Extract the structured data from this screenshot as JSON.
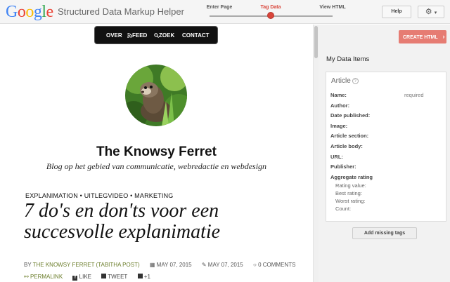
{
  "header": {
    "logo": {
      "letters": [
        {
          "char": "G",
          "color": "#4285f4"
        },
        {
          "char": "o",
          "color": "#ea4335"
        },
        {
          "char": "o",
          "color": "#fbbc05"
        },
        {
          "char": "g",
          "color": "#4285f4"
        },
        {
          "char": "l",
          "color": "#34a853"
        },
        {
          "char": "e",
          "color": "#ea4335"
        }
      ]
    },
    "app_title": "Structured Data Markup Helper",
    "steps": [
      "Enter Page",
      "Tag Data",
      "View HTML"
    ],
    "active_step_color": "#d9453a",
    "help_label": "Help",
    "settings_icon": "gear-icon",
    "settings_caret": "▾"
  },
  "page": {
    "nav": [
      "OVER",
      "FEED",
      "ZOEK",
      "CONTACT"
    ],
    "nav_icons": {
      "feed": "rss-icon",
      "zoek": "search-icon"
    },
    "blog_title": "The Knowsy Ferret",
    "blog_subtitle": "Blog op het gebied van communicatie, webredactie en webdesign",
    "categories": "EXPLANIMATION • UITLEGVIDEO • MARKETING",
    "post_title_line1": "7 do's en don'ts voor een",
    "post_title_line2": "succesvolle explanimatie",
    "meta": {
      "by": "BY",
      "author": "THE KNOWSY FERRET (TABITHA POST)",
      "published": "MAY 07, 2015",
      "modified": "MAY 07, 2015",
      "comments": "0 COMMENTS"
    },
    "share": {
      "permalink": "PERMALINK",
      "like": "LIKE",
      "tweet": "TWEET",
      "plus": "+1"
    },
    "link_color": "#6b7d2a"
  },
  "panel": {
    "create_label": "CREATE HTML",
    "create_color": "#e67c73",
    "items_title": "My Data Items",
    "item_type": "Article",
    "required_text": "required",
    "fields": [
      "Name:",
      "Author:",
      "Date published:",
      "Image:",
      "Article section:",
      "Article body:",
      "URL:",
      "Publisher:",
      "Aggregate rating"
    ],
    "subfields": [
      "Rating value:",
      "Best rating:",
      "Worst rating:",
      "Count:"
    ],
    "missing_label": "Add missing tags"
  }
}
